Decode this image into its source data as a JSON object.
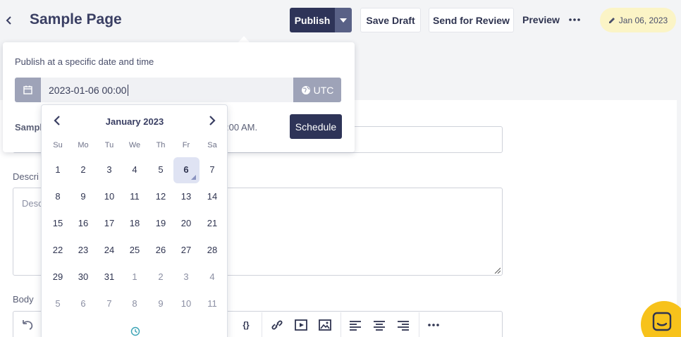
{
  "header": {
    "title": "Sample Page",
    "publish_label": "Publish",
    "save_draft_label": "Save Draft",
    "review_label": "Send for Review",
    "preview_label": "Preview",
    "date_badge": "Jan 06, 2023"
  },
  "popover": {
    "title": "Publish at a specific date and time",
    "datetime_value": "2023-01-06 00:00",
    "timezone_label": "UTC",
    "note_start": "Sampl",
    "note_end": ":00 AM.",
    "schedule_label": "Schedule"
  },
  "calendar": {
    "month_label": "January 2023",
    "weekdays": [
      "Su",
      "Mo",
      "Tu",
      "We",
      "Th",
      "Fr",
      "Sa"
    ],
    "weeks": [
      [
        "1",
        "2",
        "3",
        "4",
        "5",
        "6",
        "7"
      ],
      [
        "8",
        "9",
        "10",
        "11",
        "12",
        "13",
        "14"
      ],
      [
        "15",
        "16",
        "17",
        "18",
        "19",
        "20",
        "21"
      ],
      [
        "22",
        "23",
        "24",
        "25",
        "26",
        "27",
        "28"
      ],
      [
        "29",
        "30",
        "31",
        "1",
        "2",
        "3",
        "4"
      ],
      [
        "5",
        "6",
        "7",
        "8",
        "9",
        "10",
        "11"
      ]
    ],
    "selected_day": "6"
  },
  "form": {
    "description_label": "Descri",
    "description_placeholder": "Desc",
    "body_label": "Body"
  },
  "colors": {
    "primary": "#2e3458",
    "accent_gray": "#9ea3b8",
    "badge_yellow": "#fbf4c6",
    "chat_yellow": "#f7c21b",
    "selected_bg": "#dfe3f3"
  },
  "icons": {
    "back": "chevron-left-icon",
    "dropdown": "caret-down-icon",
    "more": "ellipsis-icon",
    "edit": "pencil-icon",
    "calendar": "calendar-icon",
    "globe": "globe-icon",
    "clock": "clock-icon",
    "chat": "chat-bubble-icon"
  }
}
